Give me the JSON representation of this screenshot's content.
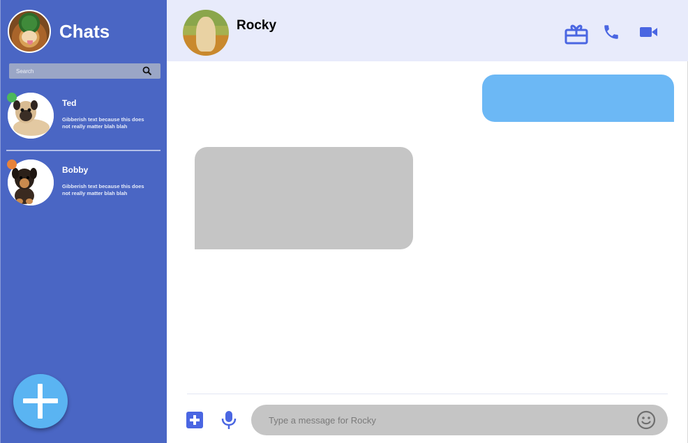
{
  "sidebar": {
    "title": "Chats",
    "search_placeholder": "Search",
    "contacts": [
      {
        "name": "Ted",
        "preview": "Gibberish text because this does not really matter blah blah",
        "status_color": "#4cb85a"
      },
      {
        "name": "Bobby",
        "preview": "Gibberish text because this does not really matter blah blah",
        "status_color": "#e8833a"
      }
    ]
  },
  "header": {
    "contact_name": "Rocky"
  },
  "composer": {
    "placeholder": "Type a message for Rocky"
  },
  "icons": [
    "search-icon",
    "gift-icon",
    "phone-icon",
    "video-camera-icon",
    "add-icon",
    "microphone-icon",
    "emoji-icon",
    "plus-icon"
  ],
  "colors": {
    "sidebar": "#4a66c4",
    "header": "#e8ebfb",
    "accent": "#4a66e2",
    "outgoing_bubble": "#6cb8f5",
    "incoming_bubble": "#c5c5c5",
    "fab": "#5ab4f2"
  }
}
